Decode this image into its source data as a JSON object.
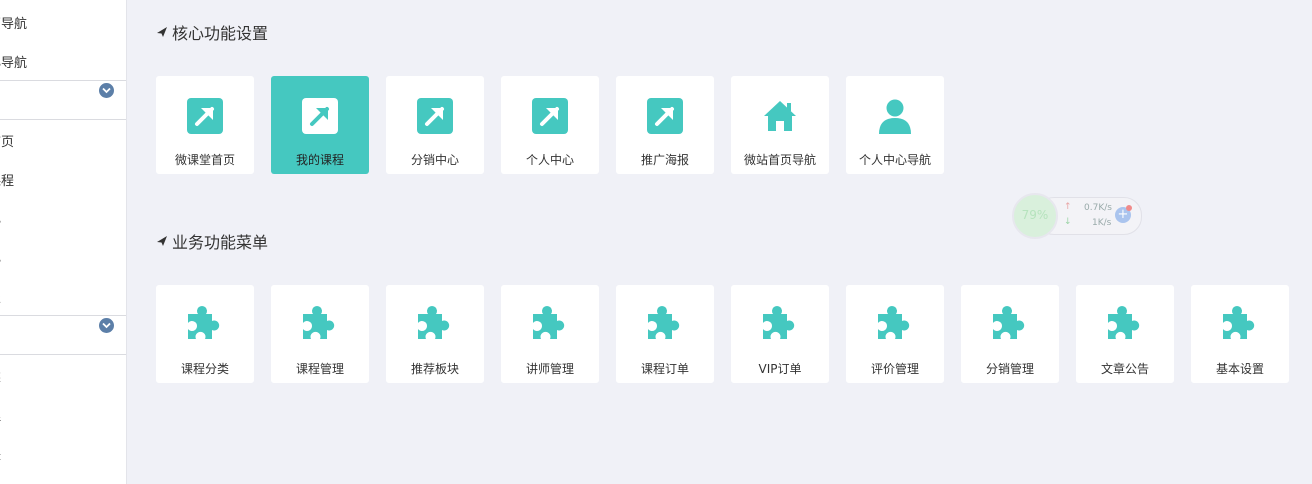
{
  "sidebar": {
    "items_top": [
      "页导航",
      "心导航"
    ],
    "items_mid": [
      "首页",
      "课程",
      "心",
      "心",
      "报"
    ],
    "items_bottom": [
      "类",
      "理",
      "块"
    ]
  },
  "core_section": {
    "title": "核心功能设置",
    "tiles": [
      {
        "label": "微课堂首页",
        "icon": "external-link-icon",
        "active": false
      },
      {
        "label": "我的课程",
        "icon": "external-link-icon",
        "active": true
      },
      {
        "label": "分销中心",
        "icon": "external-link-icon",
        "active": false
      },
      {
        "label": "个人中心",
        "icon": "external-link-icon",
        "active": false
      },
      {
        "label": "推广海报",
        "icon": "external-link-icon",
        "active": false
      },
      {
        "label": "微站首页导航",
        "icon": "home-icon",
        "active": false
      },
      {
        "label": "个人中心导航",
        "icon": "user-icon",
        "active": false
      }
    ]
  },
  "business_section": {
    "title": "业务功能菜单",
    "tiles": [
      {
        "label": "课程分类",
        "icon": "puzzle-icon"
      },
      {
        "label": "课程管理",
        "icon": "puzzle-icon"
      },
      {
        "label": "推荐板块",
        "icon": "puzzle-icon"
      },
      {
        "label": "讲师管理",
        "icon": "puzzle-icon"
      },
      {
        "label": "课程订单",
        "icon": "puzzle-icon"
      },
      {
        "label": "VIP订单",
        "icon": "puzzle-icon"
      },
      {
        "label": "评价管理",
        "icon": "puzzle-icon"
      },
      {
        "label": "分销管理",
        "icon": "puzzle-icon"
      },
      {
        "label": "文章公告",
        "icon": "puzzle-icon"
      },
      {
        "label": "基本设置",
        "icon": "puzzle-icon"
      }
    ]
  },
  "net_widget": {
    "percent": "79%",
    "upload": "0.7K/s",
    "download": "1K/s"
  },
  "colors": {
    "accent": "#45c8c0",
    "chevron": "#5c7fa8"
  }
}
